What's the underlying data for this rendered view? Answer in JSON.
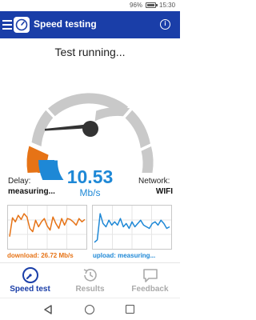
{
  "status_bar": {
    "battery": "96%",
    "time": "15:30"
  },
  "app_bar": {
    "title": "Speed testing"
  },
  "test": {
    "status": "Test running...",
    "delay_label": "Delay:",
    "delay_value": "measuring...",
    "speed_value": "10.53",
    "speed_unit": "Mb/s",
    "network_label": "Network:",
    "network_value": "WIFI"
  },
  "graphs": {
    "download_caption": "download: 26.72 Mb/s",
    "upload_caption": "upload: measuring...",
    "download_color": "#e67316",
    "upload_color": "#1e88d6",
    "download_series": [
      12,
      35,
      30,
      38,
      33,
      40,
      36,
      22,
      18,
      32,
      24,
      30,
      34,
      25,
      20,
      36,
      28,
      22,
      34,
      26,
      34,
      33,
      30,
      26,
      34,
      30,
      33
    ],
    "upload_series": [
      5,
      8,
      40,
      28,
      24,
      32,
      26,
      30,
      26,
      34,
      24,
      28,
      22,
      30,
      24,
      28,
      32,
      26,
      24,
      22,
      28,
      30,
      26,
      32,
      28,
      22,
      24
    ]
  },
  "bottom_nav": {
    "speed_test": "Speed test",
    "results": "Results",
    "feedback": "Feedback"
  },
  "colors": {
    "primary": "#1a3ea8",
    "accent_blue": "#1e88d6",
    "accent_orange": "#e67316",
    "gauge_gray": "#c9c9c9"
  }
}
